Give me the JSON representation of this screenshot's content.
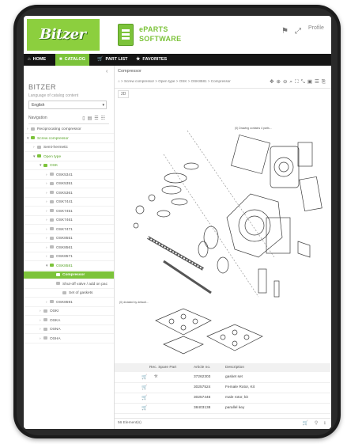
{
  "header": {
    "brand_logo": "Bitzer",
    "product_line1": "ePARTS",
    "product_line2": "SOFTWARE",
    "profile_label": "Profile",
    "icons": [
      "flag-icon",
      "fullscreen-icon"
    ]
  },
  "nav": {
    "items": [
      {
        "label": "HOME",
        "icon": "home-icon"
      },
      {
        "label": "CATALOG",
        "icon": "catalog-icon",
        "active": true
      },
      {
        "label": "PART LIST",
        "icon": "cart-icon"
      },
      {
        "label": "FAVORITES",
        "icon": "star-icon"
      }
    ]
  },
  "sidebar": {
    "brand": "BITZER",
    "language_label": "Language of catalog content",
    "language_value": "English",
    "navigation_label": "Navigation",
    "tree": [
      {
        "label": "Reciprocating compressor",
        "level": 0,
        "state": "collapsed"
      },
      {
        "label": "Screw compressor",
        "level": 0,
        "state": "expanded",
        "green": true
      },
      {
        "label": "Semi-hermetic",
        "level": 1,
        "state": "collapsed"
      },
      {
        "label": "Open type",
        "level": 1,
        "state": "expanded",
        "green": true
      },
      {
        "label": "OSK",
        "level": 2,
        "state": "expanded",
        "green": true
      },
      {
        "label": "OSK5341",
        "level": 3,
        "state": "collapsed"
      },
      {
        "label": "OSK5351",
        "level": 3,
        "state": "collapsed"
      },
      {
        "label": "OSK5361",
        "level": 3,
        "state": "collapsed"
      },
      {
        "label": "OSK7441",
        "level": 3,
        "state": "collapsed"
      },
      {
        "label": "OSK7451",
        "level": 3,
        "state": "collapsed"
      },
      {
        "label": "OSK7461",
        "level": 3,
        "state": "collapsed"
      },
      {
        "label": "OSK7471",
        "level": 3,
        "state": "collapsed"
      },
      {
        "label": "OSK8551",
        "level": 3,
        "state": "collapsed"
      },
      {
        "label": "OSK8561",
        "level": 3,
        "state": "collapsed"
      },
      {
        "label": "OSK8571",
        "level": 3,
        "state": "collapsed"
      },
      {
        "label": "OSK8581",
        "level": 3,
        "state": "expanded",
        "green": true
      },
      {
        "label": "Compressor",
        "level": 4,
        "state": "leaf",
        "selected": true
      },
      {
        "label": "Shut-off valve / add on pac",
        "level": 4,
        "state": "leaf"
      },
      {
        "label": "Set of gaskets",
        "level": 5,
        "state": "leaf"
      },
      {
        "label": "OSK8591",
        "level": 3,
        "state": "collapsed"
      },
      {
        "label": "OSKI",
        "level": 2,
        "state": "collapsed"
      },
      {
        "label": "OSKA",
        "level": 2,
        "state": "collapsed"
      },
      {
        "label": "OSNA",
        "level": 2,
        "state": "collapsed"
      },
      {
        "label": "OSHA",
        "level": 2,
        "state": "collapsed"
      }
    ]
  },
  "main": {
    "title": "Compressor",
    "breadcrumb": "⌂  >  Screw compressor  >  Open type  >  OSK  >  OSK8581  >  Compressor",
    "view_tab": "2D",
    "drawing_note_top": "(0) Drawing contains 4 parts...",
    "drawing_note_left": "(0) dictated by default...",
    "columns": [
      "Rec. Spare Part",
      "Article no.",
      "Description"
    ],
    "rows": [
      {
        "article": "37262303",
        "description": "gasket set",
        "tool": true
      },
      {
        "article": "30257524",
        "description": "Female Rotor, Kit",
        "tool": false
      },
      {
        "article": "30257446",
        "description": "male rotor, kit",
        "tool": false
      },
      {
        "article": "38403138",
        "description": "parallel key",
        "tool": false
      }
    ],
    "element_count": "56 Element(s)"
  }
}
